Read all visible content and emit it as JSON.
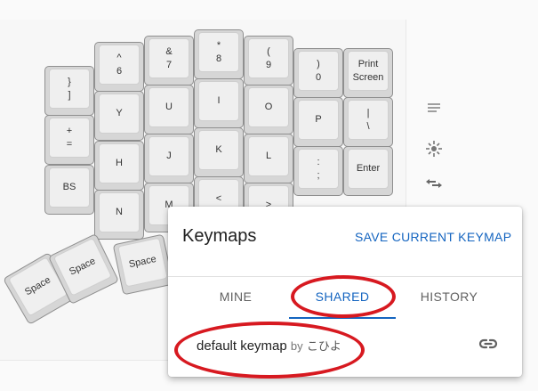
{
  "keyboard": {
    "keys": [
      {
        "top": "}",
        "bottom": "]"
      },
      {
        "top": "+",
        "bottom": "="
      },
      {
        "top": "",
        "bottom": "BS"
      },
      {
        "top": "^",
        "bottom": "6"
      },
      {
        "top": "",
        "bottom": "Y"
      },
      {
        "top": "",
        "bottom": "H"
      },
      {
        "top": "",
        "bottom": "N"
      },
      {
        "top": "&",
        "bottom": "7"
      },
      {
        "top": "",
        "bottom": "U"
      },
      {
        "top": "",
        "bottom": "J"
      },
      {
        "top": "",
        "bottom": "M"
      },
      {
        "top": "*",
        "bottom": "8"
      },
      {
        "top": "",
        "bottom": "I"
      },
      {
        "top": "",
        "bottom": "K"
      },
      {
        "top": "<",
        "bottom": ""
      },
      {
        "top": "(",
        "bottom": "9"
      },
      {
        "top": "",
        "bottom": "O"
      },
      {
        "top": "",
        "bottom": "L"
      },
      {
        "top": ">",
        "bottom": ""
      },
      {
        "top": ")",
        "bottom": "0"
      },
      {
        "top": "",
        "bottom": "P"
      },
      {
        "top": ":",
        "bottom": ";"
      },
      {
        "top": "Print",
        "bottom": "Screen"
      },
      {
        "top": "|",
        "bottom": "\\"
      },
      {
        "top": "",
        "bottom": "Enter"
      },
      {
        "top": "",
        "bottom": "Space"
      },
      {
        "top": "",
        "bottom": "Space"
      },
      {
        "top": "",
        "bottom": "Space"
      }
    ]
  },
  "side_icons": [
    "notes-icon",
    "light-icon",
    "swap-icon"
  ],
  "card": {
    "title": "Keymaps",
    "action": "SAVE CURRENT KEYMAP",
    "tabs": [
      "MINE",
      "SHARED",
      "HISTORY"
    ],
    "active_tab": "SHARED",
    "item": {
      "name": "default keymap",
      "by": "by",
      "author": "こひよ",
      "icon": "link-icon"
    },
    "annotation_color": "#d71920",
    "accent_color": "#1565c0"
  }
}
